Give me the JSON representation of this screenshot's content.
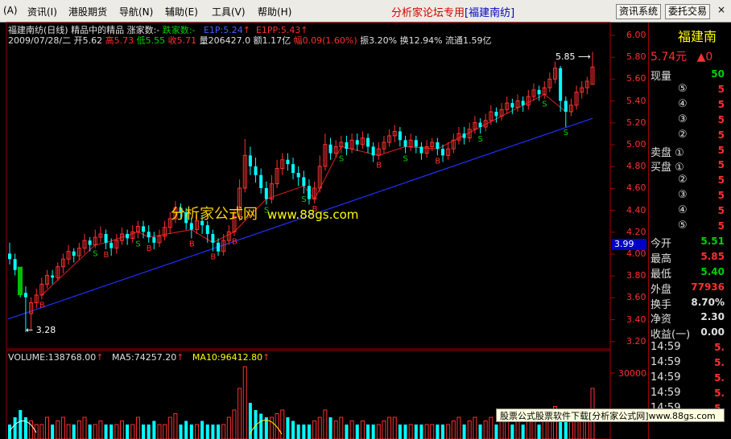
{
  "menubar": {
    "items": [
      "(A)",
      "资讯(I)",
      "港股期货",
      "导航(N)",
      "辅助(E)",
      "工具(V)",
      "帮助(H)"
    ],
    "title_prefix": "分析家论坛专用",
    "title_stock": "[福建南纺]",
    "btn_info": "资讯系统",
    "btn_trade": "委托交易",
    "close": "×"
  },
  "chart_info": {
    "line1_name": "福建南纺(日线) 精品中的精品",
    "line1_up": "涨家数:-",
    "line1_down": "跌家数:-",
    "line1_e1p": "E1P:5.24",
    "line1_e1pp": "E1PP:5.43",
    "line2_date": "2009/07/28/二",
    "line2_open": "开5.62",
    "line2_high": "高5.73",
    "line2_low": "低5.55",
    "line2_close": "收5.71",
    "line2_vol": "量206427.0",
    "line2_amt": "额1.17亿",
    "line2_chg": "幅0.09(1.60%)",
    "line2_rest": "振3.20% 换12.94% 流通1.59亿"
  },
  "y_axis": [
    "6.00",
    "5.80",
    "5.60",
    "5.40",
    "5.20",
    "5.00",
    "4.80",
    "4.60",
    "4.40",
    "4.20",
    "4.00",
    "3.80",
    "3.60",
    "3.40",
    "3.20"
  ],
  "current_price_tag": "3.99",
  "annotations": {
    "high": "5.85",
    "low": "3.28"
  },
  "watermark": {
    "cn": "分析家公式网",
    "url": "www.88gs.com"
  },
  "volume_info": {
    "vol": "VOLUME:138768.00",
    "ma5": "MA5:74257.20",
    "ma10": "MA10:96412.80",
    "axis": "30000"
  },
  "side": {
    "title": "福建南",
    "price": "5.74元",
    "change_arrow": "▲0",
    "rows": [
      {
        "label": "现量",
        "value": "50",
        "color": "#00d000"
      },
      {
        "label": "⑤",
        "value": "5",
        "color": "#ff3030"
      },
      {
        "label": "④",
        "value": "5",
        "color": "#ff3030"
      },
      {
        "label": "③",
        "value": "5",
        "color": "#ff3030"
      },
      {
        "label": "②",
        "value": "5",
        "color": "#ff3030"
      },
      {
        "label": "卖盘 ①",
        "value": "5",
        "color": "#ff3030"
      },
      {
        "label": "买盘 ①",
        "value": "5",
        "color": "#ff3030"
      },
      {
        "label": "②",
        "value": "5",
        "color": "#ff3030"
      },
      {
        "label": "③",
        "value": "5",
        "color": "#ff3030"
      },
      {
        "label": "④",
        "value": "5",
        "color": "#ff3030"
      },
      {
        "label": "⑤",
        "value": "5",
        "color": "#ff3030"
      },
      {
        "label": "今开",
        "value": "5.51",
        "color": "#00d000"
      },
      {
        "label": "最高",
        "value": "5.85",
        "color": "#ff3030"
      },
      {
        "label": "最低",
        "value": "5.40",
        "color": "#00d000"
      },
      {
        "label": "外盘",
        "value": "77936",
        "color": "#ff3030"
      },
      {
        "label": "换手",
        "value": "8.70%",
        "color": "#e0e0e0"
      },
      {
        "label": "净资",
        "value": "2.30",
        "color": "#e0e0e0"
      },
      {
        "label": "收益(一)",
        "value": "0.00",
        "color": "#e0e0e0"
      },
      {
        "label": "14:59",
        "value": "5.",
        "color": "#ff3030"
      },
      {
        "label": "14:59",
        "value": "5.",
        "color": "#ff3030"
      },
      {
        "label": "14:59",
        "value": "5.",
        "color": "#ff3030"
      },
      {
        "label": "14:59",
        "value": "5.",
        "color": "#ff3030"
      },
      {
        "label": "14:59",
        "value": "5.",
        "color": "#ff3030"
      }
    ]
  },
  "footer": "股票公式股票软件下载[分析家公式网]www.88gs.com",
  "candles": [
    [
      4.0,
      3.95,
      3.9,
      4.1
    ],
    [
      3.95,
      3.85,
      3.8,
      4.0
    ],
    [
      3.8,
      3.64,
      3.6,
      3.85
    ],
    [
      3.64,
      3.6,
      3.28,
      3.7
    ],
    [
      3.45,
      3.55,
      3.3,
      3.6
    ],
    [
      3.55,
      3.62,
      3.5,
      3.68
    ],
    [
      3.62,
      3.72,
      3.58,
      3.78
    ],
    [
      3.72,
      3.8,
      3.68,
      3.85
    ],
    [
      3.8,
      3.78,
      3.72,
      3.85
    ],
    [
      3.78,
      3.88,
      3.75,
      3.92
    ],
    [
      3.88,
      3.95,
      3.82,
      4.0
    ],
    [
      3.95,
      4.02,
      3.9,
      4.08
    ],
    [
      4.02,
      3.98,
      3.92,
      4.05
    ],
    [
      3.98,
      4.05,
      3.94,
      4.1
    ],
    [
      4.05,
      4.12,
      4.0,
      4.18
    ],
    [
      4.12,
      4.08,
      4.02,
      4.15
    ],
    [
      4.08,
      4.15,
      4.05,
      4.22
    ],
    [
      4.15,
      4.18,
      4.1,
      4.25
    ],
    [
      4.18,
      4.1,
      4.04,
      4.22
    ],
    [
      4.1,
      4.05,
      3.98,
      4.14
    ],
    [
      4.05,
      4.12,
      4.0,
      4.18
    ],
    [
      4.12,
      4.18,
      4.08,
      4.24
    ],
    [
      4.18,
      4.14,
      4.08,
      4.22
    ],
    [
      4.14,
      4.2,
      4.1,
      4.26
    ],
    [
      4.2,
      4.25,
      4.14,
      4.3
    ],
    [
      4.25,
      4.2,
      4.14,
      4.3
    ],
    [
      4.2,
      4.15,
      4.1,
      4.26
    ],
    [
      4.15,
      4.1,
      4.04,
      4.2
    ],
    [
      4.1,
      4.16,
      4.06,
      4.22
    ],
    [
      4.16,
      4.24,
      4.12,
      4.3
    ],
    [
      4.24,
      4.32,
      4.18,
      4.38
    ],
    [
      4.32,
      4.42,
      4.28,
      4.48
    ],
    [
      4.42,
      4.38,
      4.32,
      4.46
    ],
    [
      4.38,
      4.28,
      4.22,
      4.42
    ],
    [
      4.28,
      4.22,
      4.14,
      4.32
    ],
    [
      4.22,
      4.3,
      4.18,
      4.36
    ],
    [
      4.3,
      4.26,
      4.18,
      4.34
    ],
    [
      4.26,
      4.18,
      4.1,
      4.3
    ],
    [
      4.18,
      4.1,
      4.02,
      4.22
    ],
    [
      4.1,
      4.02,
      3.98,
      4.14
    ],
    [
      4.02,
      4.12,
      3.98,
      4.18
    ],
    [
      4.12,
      4.2,
      4.08,
      4.26
    ],
    [
      4.2,
      4.34,
      4.16,
      4.4
    ],
    [
      4.34,
      4.6,
      4.3,
      4.68
    ],
    [
      4.6,
      4.9,
      4.56,
      5.05
    ],
    [
      4.9,
      4.8,
      4.72,
      4.98
    ],
    [
      4.8,
      4.72,
      4.65,
      4.88
    ],
    [
      4.72,
      4.6,
      4.55,
      4.78
    ],
    [
      4.6,
      4.5,
      4.45,
      4.66
    ],
    [
      4.5,
      4.64,
      4.46,
      4.72
    ],
    [
      4.64,
      4.78,
      4.6,
      4.86
    ],
    [
      4.78,
      4.86,
      4.72,
      4.92
    ],
    [
      4.86,
      4.82,
      4.76,
      4.92
    ],
    [
      4.82,
      4.74,
      4.68,
      4.88
    ],
    [
      4.74,
      4.7,
      4.62,
      4.8
    ],
    [
      4.7,
      4.62,
      4.55,
      4.76
    ],
    [
      4.62,
      4.5,
      4.45,
      4.68
    ],
    [
      4.5,
      4.6,
      4.46,
      4.66
    ],
    [
      4.6,
      4.8,
      4.56,
      4.9
    ],
    [
      4.8,
      5.0,
      4.76,
      5.1
    ],
    [
      5.0,
      4.92,
      4.86,
      5.06
    ],
    [
      4.92,
      4.98,
      4.88,
      5.04
    ],
    [
      4.98,
      5.02,
      4.92,
      5.08
    ],
    [
      5.02,
      4.96,
      4.9,
      5.08
    ],
    [
      4.96,
      5.04,
      4.92,
      5.1
    ],
    [
      5.04,
      5.0,
      4.94,
      5.1
    ],
    [
      5.0,
      5.06,
      4.96,
      5.12
    ],
    [
      5.06,
      4.98,
      4.92,
      5.1
    ],
    [
      4.98,
      4.9,
      4.84,
      5.02
    ],
    [
      4.9,
      4.96,
      4.86,
      5.02
    ],
    [
      4.96,
      5.02,
      4.92,
      5.08
    ],
    [
      5.02,
      5.08,
      4.98,
      5.14
    ],
    [
      5.08,
      5.12,
      5.02,
      5.18
    ],
    [
      5.12,
      5.04,
      4.98,
      5.16
    ],
    [
      5.04,
      4.98,
      4.92,
      5.08
    ],
    [
      4.98,
      5.04,
      4.94,
      5.1
    ],
    [
      5.04,
      4.98,
      4.92,
      5.08
    ],
    [
      4.98,
      4.92,
      4.86,
      5.02
    ],
    [
      4.92,
      4.98,
      4.88,
      5.04
    ],
    [
      4.98,
      5.02,
      4.94,
      5.06
    ],
    [
      5.02,
      4.96,
      4.9,
      5.06
    ],
    [
      4.96,
      4.9,
      4.84,
      5.0
    ],
    [
      4.9,
      4.96,
      4.86,
      5.02
    ],
    [
      4.96,
      5.04,
      4.92,
      5.1
    ],
    [
      5.04,
      5.1,
      5.0,
      5.16
    ],
    [
      5.1,
      5.06,
      5.0,
      5.16
    ],
    [
      5.06,
      5.14,
      5.02,
      5.2
    ],
    [
      5.14,
      5.2,
      5.1,
      5.26
    ],
    [
      5.2,
      5.16,
      5.1,
      5.24
    ],
    [
      5.16,
      5.22,
      5.12,
      5.28
    ],
    [
      5.22,
      5.3,
      5.18,
      5.36
    ],
    [
      5.3,
      5.26,
      5.2,
      5.34
    ],
    [
      5.26,
      5.32,
      5.22,
      5.38
    ],
    [
      5.32,
      5.38,
      5.28,
      5.44
    ],
    [
      5.38,
      5.34,
      5.28,
      5.42
    ],
    [
      5.34,
      5.4,
      5.3,
      5.46
    ],
    [
      5.4,
      5.36,
      5.3,
      5.44
    ],
    [
      5.36,
      5.44,
      5.32,
      5.5
    ],
    [
      5.44,
      5.5,
      5.4,
      5.56
    ],
    [
      5.5,
      5.46,
      5.4,
      5.54
    ],
    [
      5.46,
      5.52,
      5.42,
      5.58
    ],
    [
      5.52,
      5.6,
      5.48,
      5.66
    ],
    [
      5.6,
      5.7,
      5.56,
      5.76
    ],
    [
      5.7,
      5.4,
      5.3,
      5.72
    ],
    [
      5.4,
      5.3,
      5.16,
      5.44
    ],
    [
      5.3,
      5.36,
      5.26,
      5.42
    ],
    [
      5.36,
      5.48,
      5.32,
      5.54
    ],
    [
      5.48,
      5.52,
      5.42,
      5.58
    ],
    [
      5.52,
      5.58,
      5.46,
      5.62
    ],
    [
      5.55,
      5.71,
      5.55,
      5.85
    ]
  ],
  "signals": [
    {
      "i": 6,
      "t": "B"
    },
    {
      "i": 18,
      "t": "B"
    },
    {
      "i": 16,
      "t": "S"
    },
    {
      "i": 26,
      "t": "B"
    },
    {
      "i": 24,
      "t": "S"
    },
    {
      "i": 34,
      "t": "B"
    },
    {
      "i": 38,
      "t": "B"
    },
    {
      "i": 42,
      "t": "B"
    },
    {
      "i": 48,
      "t": "S"
    },
    {
      "i": 55,
      "t": "S"
    },
    {
      "i": 57,
      "t": "B"
    },
    {
      "i": 62,
      "t": "S"
    },
    {
      "i": 69,
      "t": "B"
    },
    {
      "i": 74,
      "t": "S"
    },
    {
      "i": 80,
      "t": "B"
    },
    {
      "i": 88,
      "t": "S"
    },
    {
      "i": 100,
      "t": "S"
    },
    {
      "i": 104,
      "t": "S"
    }
  ],
  "volumes": [
    0.2,
    0.3,
    0.4,
    0.3,
    0.25,
    0.2,
    0.2,
    0.3,
    0.2,
    0.25,
    0.3,
    0.2,
    0.2,
    0.25,
    0.3,
    0.2,
    0.2,
    0.25,
    0.2,
    0.2,
    0.2,
    0.25,
    0.2,
    0.2,
    0.3,
    0.2,
    0.2,
    0.25,
    0.2,
    0.2,
    0.3,
    0.35,
    0.2,
    0.25,
    0.2,
    0.2,
    0.25,
    0.2,
    0.2,
    0.2,
    0.2,
    0.3,
    0.4,
    0.7,
    1.0,
    0.5,
    0.4,
    0.35,
    0.3,
    0.3,
    0.35,
    0.4,
    0.3,
    0.25,
    0.2,
    0.2,
    0.2,
    0.25,
    0.3,
    0.4,
    0.3,
    0.25,
    0.3,
    0.2,
    0.25,
    0.2,
    0.25,
    0.2,
    0.2,
    0.2,
    0.25,
    0.3,
    0.3,
    0.2,
    0.2,
    0.2,
    0.2,
    0.2,
    0.2,
    0.2,
    0.2,
    0.2,
    0.2,
    0.25,
    0.3,
    0.2,
    0.25,
    0.3,
    0.2,
    0.25,
    0.3,
    0.2,
    0.25,
    0.3,
    0.2,
    0.25,
    0.2,
    0.3,
    0.3,
    0.2,
    0.25,
    0.3,
    0.45,
    0.4,
    0.35,
    0.25,
    0.3,
    0.35,
    0.3,
    0.7
  ]
}
